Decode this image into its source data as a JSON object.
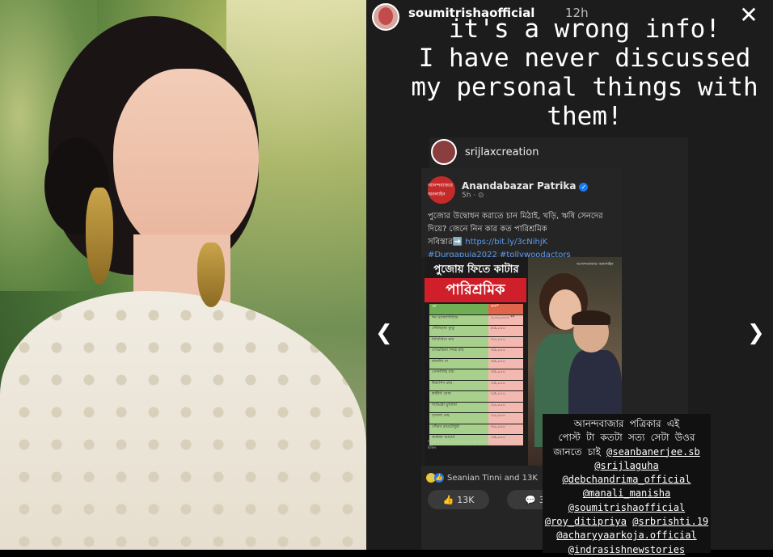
{
  "story": {
    "username": "soumitrishaofficial",
    "time": "12h",
    "caption_lines": [
      "it's a wrong info!",
      "I have never discussed",
      "my personal things with",
      "them!"
    ]
  },
  "reshare": {
    "username": "srijlaxcreation"
  },
  "fb_post": {
    "page_name": "Anandabazar Patrika",
    "logo_text": "আনন্দবাজার অনলাইন",
    "time": "5h · ⊙",
    "text_line1": "পুজোর উদ্বোধন করাতে চান মিঠাই, খড়ি, ঋষি সেনদের",
    "text_line2": "দিয়ে? জেনে নিন কার কত পারিশ্রমিক",
    "text_prefix": "সবিস্তার➡️ ",
    "link": "https://bit.ly/3cNihjK",
    "hashtags": "#Durgapuja2022 #tollywoodactors",
    "reactions": "Seanian Tinni and 13K",
    "like_count": "13K",
    "comment_count": "3K"
  },
  "promo": {
    "title_top": "পুজোয় ফিতে কাটার",
    "title_main": "পারিশ্রমিক",
    "brand": "আনন্দবাজার অনলাইন",
    "header": {
      "name": "কে",
      "value": "কত*"
    },
    "rows": [
      {
        "name": "শন বন্দ্যোপাধ্যায়",
        "value": "১,০০,০০০ **"
      },
      {
        "name": "সৌমিতৃষা কুণ্ডু",
        "value": "৮৫,০০০"
      },
      {
        "name": "দিতিপ্রিয়া রায়",
        "value": "৭০,০০০"
      },
      {
        "name": "দেবচন্দ্রিমা সিংহ রায়",
        "value": "৩৫,০০০"
      },
      {
        "name": "মানালি দে",
        "value": "৩৫,০০০"
      },
      {
        "name": "সোনালিহ রায়",
        "value": "৩৫,০০০"
      },
      {
        "name": "ঈন্দ্রাশিস রায়",
        "value": "২৫,০০০"
      },
      {
        "name": "শ্রাইতি ঘোষ",
        "value": "২৫,০০০"
      },
      {
        "name": "শ্যামৈত্রী মুখার্জি",
        "value": "২০,০০০"
      },
      {
        "name": "সৃজলা গুহ",
        "value": "২০,০০০"
      },
      {
        "name": "গৌরব রায়চৌধুরী",
        "value": "৩০,০০০"
      },
      {
        "name": "অর্কজা আচার্য",
        "value": "১৫,০০০"
      }
    ],
    "note": "* সম্ভাব্য ব্যাবস্থা। জনসংযোগ অনুযায়ী পারিশ্রমিক বদলে ** জন-বিবেচন চিহ্নিত"
  },
  "tag_box": {
    "line1": "আনন্দবাজার পত্রিকার এই",
    "line2": "পোস্ট টা কতটা সত্য সেটা উওর",
    "line3_prefix": "জানতে চাই ",
    "mentions": [
      "@seanbanerjee.sb",
      "@srijlaguha",
      "@debchandrima_official",
      "@manali_manisha",
      "@soumitrishaofficial",
      "@roy_ditipriya",
      "@srbrishti.19",
      "@acharyyaarkoja.official",
      "@indrasishnewstories"
    ]
  },
  "icons": {
    "close": "close-icon",
    "prev": "chevron-left-icon",
    "next": "chevron-right-icon",
    "like": "thumbs-up-icon",
    "comment": "comment-icon",
    "verified": "verified-badge-icon"
  }
}
